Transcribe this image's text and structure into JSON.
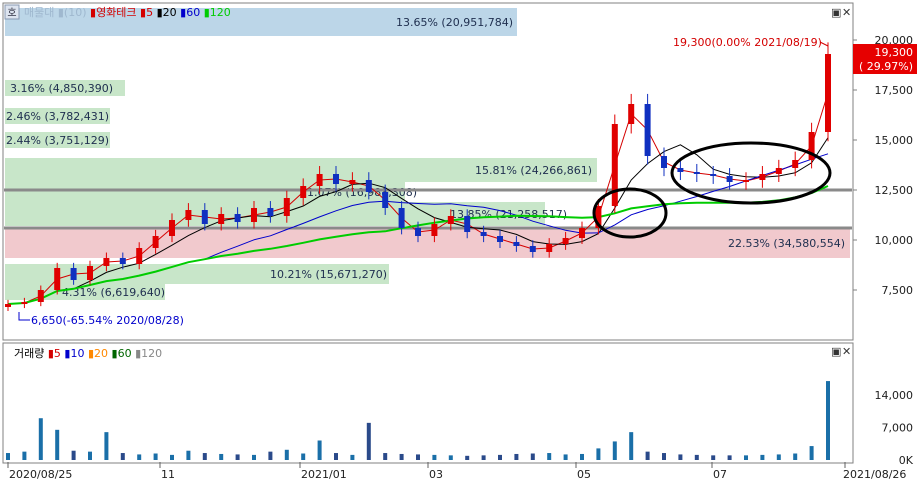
{
  "panel_legend": {
    "badge": "호",
    "price_items": [
      {
        "label": "매물대",
        "color": "#9fb8cf"
      },
      {
        "label": "(10)",
        "color": "#9fb8cf"
      },
      {
        "label": "영화테크",
        "color": "#d40000"
      },
      {
        "label": "5",
        "color": "#d40000"
      },
      {
        "label": "20",
        "color": "#000000"
      },
      {
        "label": "60",
        "color": "#0000cc"
      },
      {
        "label": "120",
        "color": "#00cc00"
      }
    ],
    "volume_items": [
      {
        "label": "거래량",
        "color": "#000000"
      },
      {
        "label": "5",
        "color": "#d40000"
      },
      {
        "label": "10",
        "color": "#0000cc"
      },
      {
        "label": "20",
        "color": "#ff8800"
      },
      {
        "label": "60",
        "color": "#006600"
      },
      {
        "label": "120",
        "color": "#888888"
      }
    ]
  },
  "window_buttons": {
    "restore": "▣",
    "close": "✕"
  },
  "price_axis_labels": [
    "20,000",
    "17,500",
    "15,000",
    "12,500",
    "10,000",
    "7,500"
  ],
  "volume_axis_labels": [
    "14,000",
    "7,000",
    "0K"
  ],
  "date_labels": [
    "2020/08/25",
    "11",
    "2021/01",
    "03",
    "05",
    "07",
    "2021/08/26"
  ],
  "price_tag": {
    "value": "19,300",
    "change": "( 29.97%)"
  },
  "annotations": {
    "high": "19,300(0.00% 2021/08/19)",
    "low": "6,650(-65.54% 2020/08/28)"
  },
  "volume_profile": [
    {
      "label": "13.65% (20,951,784)",
      "color": "#bcd6e8"
    },
    {
      "label": "3.16% (4,850,390)",
      "color": "#c8e6c9"
    },
    {
      "label": "2.46% (3,782,431)",
      "color": "#c8e6c9"
    },
    {
      "label": "2.44% (3,751,129)",
      "color": "#c8e6c9"
    },
    {
      "label": "15.81% (24,266,861)",
      "color": "#c8e6c9"
    },
    {
      "label": "11.07% (16,988,308)",
      "color": "#c8e6c9"
    },
    {
      "label": "13.85% (21,258,517)",
      "color": "#c8e6c9"
    },
    {
      "label": "22.53% (34,580,554)",
      "color": "#f1c9cd"
    },
    {
      "label": "10.21% (15,671,270)",
      "color": "#c8e6c9"
    },
    {
      "label": "4.31% (6,619,640)",
      "color": "#c8e6c9"
    }
  ],
  "chart_data": {
    "type": "candlestick",
    "price_axis": {
      "ylim": [
        5000,
        21500
      ],
      "ticks": [
        20000,
        17500,
        15000,
        12500,
        10000,
        7500
      ]
    },
    "volume_axis": {
      "ylim": [
        0,
        19000
      ],
      "ticks": [
        14000,
        7000,
        0
      ]
    },
    "horizontal_lines": [
      12500,
      10600
    ],
    "highlight_ellipses": [
      "2021/05 breakout",
      "2021/07 consolidation"
    ],
    "volume_profile_bands": [
      {
        "low": 20200,
        "high": 21600,
        "pct": 13.65,
        "shares": 20951784
      },
      {
        "low": 17200,
        "high": 18000,
        "pct": 3.16,
        "shares": 4850390
      },
      {
        "low": 15800,
        "high": 16600,
        "pct": 2.46,
        "shares": 3782431
      },
      {
        "low": 14600,
        "high": 15400,
        "pct": 2.44,
        "shares": 3751129
      },
      {
        "low": 12900,
        "high": 14100,
        "pct": 15.81,
        "shares": 24266861
      },
      {
        "low": 11900,
        "high": 12900,
        "pct": 11.07,
        "shares": 16988308
      },
      {
        "low": 10700,
        "high": 11900,
        "pct": 13.85,
        "shares": 21258517
      },
      {
        "low": 9100,
        "high": 10600,
        "pct": 22.53,
        "shares": 34580554
      },
      {
        "low": 7800,
        "high": 8800,
        "pct": 10.21,
        "shares": 15671270
      },
      {
        "low": 7000,
        "high": 7800,
        "pct": 4.31,
        "shares": 6619640
      }
    ],
    "weekly_close": [
      6800,
      6900,
      7500,
      8600,
      8000,
      8700,
      9100,
      8800,
      9600,
      10200,
      11000,
      11500,
      10800,
      11300,
      10900,
      11600,
      11200,
      12100,
      12700,
      13300,
      12800,
      13000,
      12400,
      11600,
      10600,
      10200,
      10800,
      11200,
      10400,
      10200,
      9900,
      9700,
      9400,
      9800,
      10100,
      10600,
      11700,
      15800,
      16800,
      14200,
      13600,
      13400,
      13300,
      13200,
      12900,
      13000,
      13300,
      13600,
      14000,
      15400,
      19300
    ],
    "volume": [
      1500,
      1800,
      9000,
      6500,
      2000,
      1800,
      6000,
      1500,
      1200,
      1400,
      1100,
      2000,
      1500,
      1300,
      1200,
      1100,
      1800,
      2200,
      1400,
      4200,
      1500,
      1100,
      8000,
      1500,
      1300,
      1200,
      1100,
      1000,
      900,
      1000,
      1100,
      1300,
      1400,
      1500,
      1200,
      1300,
      2500,
      4000,
      6000,
      1800,
      1500,
      1200,
      1100,
      1000,
      1000,
      1000,
      1100,
      1200,
      1400,
      3000,
      17000
    ],
    "series": [
      {
        "name": "5",
        "color": "#d40000"
      },
      {
        "name": "20",
        "color": "#000000"
      },
      {
        "name": "60",
        "color": "#0000cc"
      },
      {
        "name": "120",
        "color": "#00cc00"
      }
    ],
    "x_dates": [
      "2020/08/25",
      "11",
      "2021/01",
      "03",
      "05",
      "07",
      "2021/08/26"
    ]
  }
}
